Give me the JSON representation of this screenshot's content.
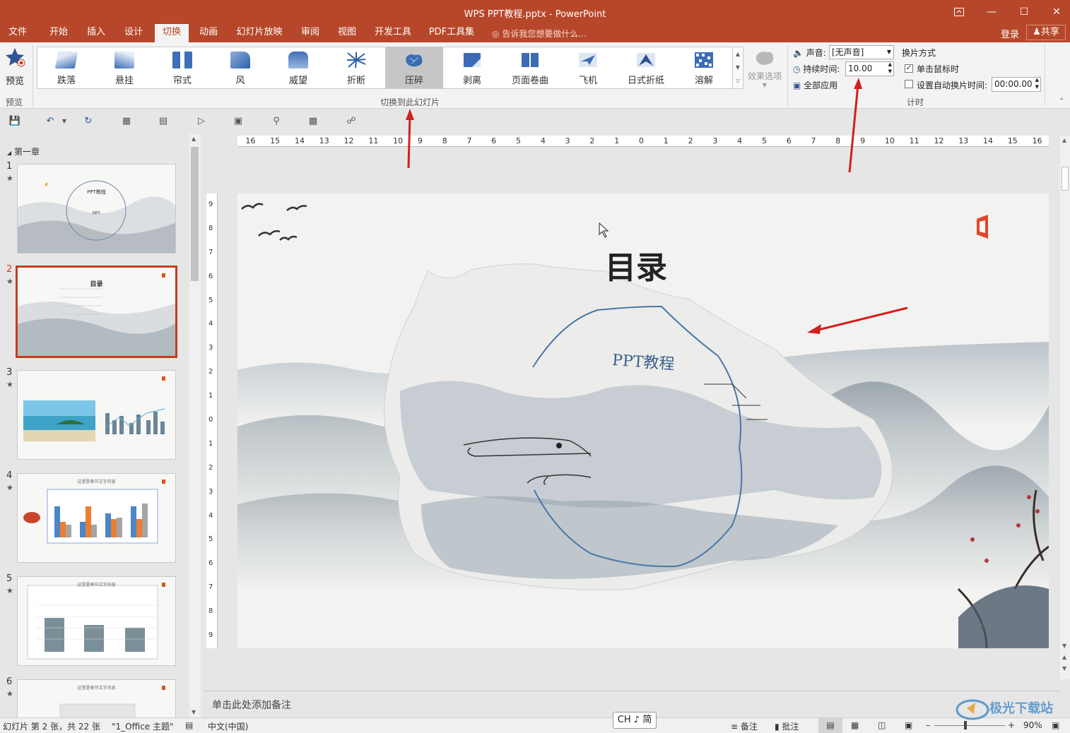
{
  "window": {
    "title": "WPS PPT教程.pptx - PowerPoint"
  },
  "menu": {
    "tabs": [
      {
        "label": "文件"
      },
      {
        "label": "开始"
      },
      {
        "label": "插入"
      },
      {
        "label": "设计"
      },
      {
        "label": "切换"
      },
      {
        "label": "动画"
      },
      {
        "label": "幻灯片放映"
      },
      {
        "label": "审阅"
      },
      {
        "label": "视图"
      },
      {
        "label": "开发工具"
      },
      {
        "label": "PDF工具集"
      }
    ],
    "active_tab": "切换",
    "tell_me": "告诉我您想要做什么...",
    "login": "登录",
    "share": "共享"
  },
  "ribbon": {
    "preview": {
      "label": "预览",
      "group_label": "预览"
    },
    "transitions": [
      {
        "label": "跌落",
        "icon": "fall-over-icon"
      },
      {
        "label": "悬挂",
        "icon": "drape-icon"
      },
      {
        "label": "帘式",
        "icon": "curtains-icon"
      },
      {
        "label": "风",
        "icon": "wind-icon"
      },
      {
        "label": "威望",
        "icon": "prestige-icon"
      },
      {
        "label": "折断",
        "icon": "fracture-icon"
      },
      {
        "label": "压碎",
        "icon": "crush-icon"
      },
      {
        "label": "剥离",
        "icon": "peel-off-icon"
      },
      {
        "label": "页面卷曲",
        "icon": "page-curl-icon"
      },
      {
        "label": "飞机",
        "icon": "airplane-icon"
      },
      {
        "label": "日式折纸",
        "icon": "origami-icon"
      },
      {
        "label": "溶解",
        "icon": "dissolve-icon"
      }
    ],
    "selected_transition": "压碎",
    "effect_options": "效果选项",
    "group_transition_label": "切换到此幻灯片",
    "timing": {
      "sound_label": "声音:",
      "sound_value": "[无声音]",
      "duration_label": "持续时间:",
      "duration_value": "10.00",
      "apply_all": "全部应用",
      "advance_label": "换片方式",
      "on_click": "单击鼠标时",
      "on_click_checked": true,
      "after_label": "设置自动换片时间:",
      "after_checked": false,
      "after_value": "00:00.00",
      "group_label": "计时"
    }
  },
  "slides_pane": {
    "section": "第一章",
    "slides": [
      {
        "num": "1",
        "title": "PPT教程",
        "sub": "PPT"
      },
      {
        "num": "2",
        "title": "目录"
      },
      {
        "num": "3",
        "title": ""
      },
      {
        "num": "4",
        "title": "这里是章节文字内容"
      },
      {
        "num": "5",
        "title": "这里是章节文字内容"
      },
      {
        "num": "6",
        "title": "这里是章节文字内容"
      }
    ],
    "selected": "2"
  },
  "ruler": {
    "h_ticks": [
      "16",
      "15",
      "14",
      "13",
      "12",
      "11",
      "10",
      "9",
      "8",
      "7",
      "6",
      "5",
      "4",
      "3",
      "2",
      "1",
      "0",
      "1",
      "2",
      "3",
      "4",
      "5",
      "6",
      "7",
      "8",
      "9",
      "10",
      "11",
      "12",
      "13",
      "14",
      "15",
      "16"
    ],
    "v_ticks": [
      "9",
      "8",
      "7",
      "6",
      "5",
      "4",
      "3",
      "2",
      "1",
      "0",
      "1",
      "2",
      "3",
      "4",
      "5",
      "6",
      "7",
      "8",
      "9"
    ]
  },
  "slide": {
    "title": "目录",
    "paper_text": "PPT教程",
    "page_number": "2"
  },
  "notes": {
    "placeholder": "单击此处添加备注"
  },
  "status": {
    "slide_info": "幻灯片 第 2 张，共 22 张",
    "theme": "\"1_Office 主题\"",
    "language": "中文(中国)",
    "notes_btn": "备注",
    "comments_btn": "批注",
    "zoom": "90%"
  },
  "ime": {
    "text": "CH ♪ 简"
  },
  "colors": {
    "accent": "#b7472a",
    "selected_border": "#c43e1c",
    "arrow": "#d21f1f"
  }
}
